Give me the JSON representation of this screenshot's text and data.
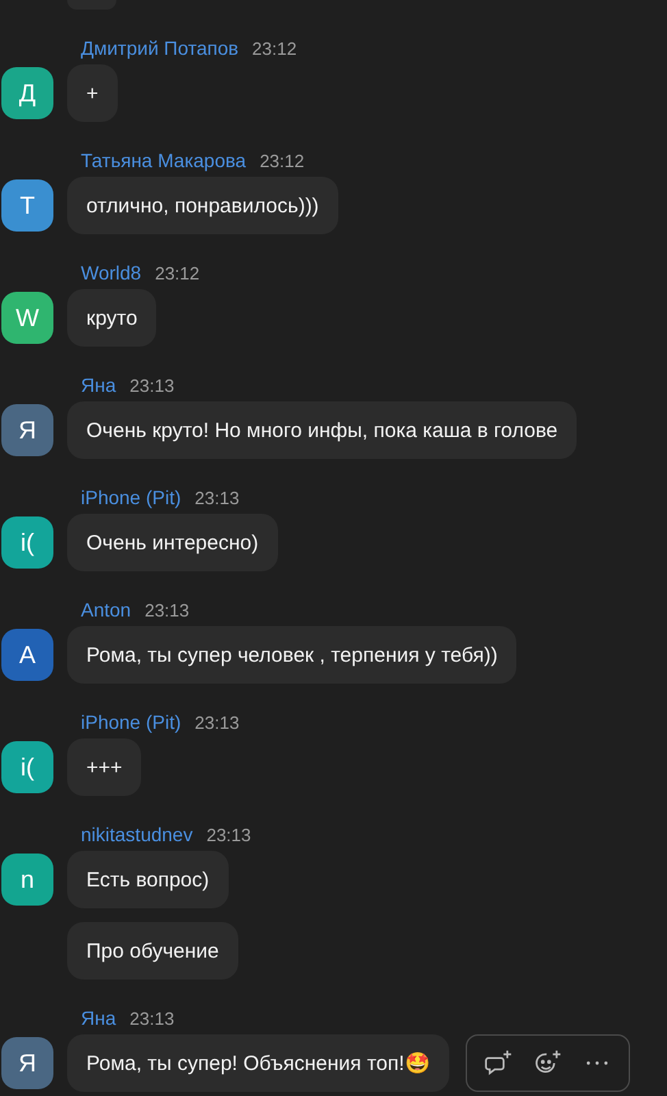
{
  "messages": [
    {
      "author": "Дмитрий Потапов",
      "time": "23:12",
      "avatar": "Д",
      "color": "#1aa68a",
      "bubbles": [
        "+"
      ],
      "hovered": false
    },
    {
      "author": "Татьяна Макарова",
      "time": "23:12",
      "avatar": "Т",
      "color": "#3a8fd0",
      "bubbles": [
        "отлично, понравилось)))"
      ],
      "hovered": false
    },
    {
      "author": "World8",
      "time": "23:12",
      "avatar": "W",
      "color": "#2fb56f",
      "bubbles": [
        "круто"
      ],
      "hovered": false
    },
    {
      "author": "Яна",
      "time": "23:13",
      "avatar": "Я",
      "color": "#4a6783",
      "bubbles": [
        "Очень круто! Но много инфы, пока каша в голове"
      ],
      "hovered": false
    },
    {
      "author": "iPhone (Pit)",
      "time": "23:13",
      "avatar": "i(",
      "color": "#13a59a",
      "bubbles": [
        "Очень интересно)"
      ],
      "hovered": false
    },
    {
      "author": "Anton",
      "time": "23:13",
      "avatar": "A",
      "color": "#2262b4",
      "bubbles": [
        "Рома, ты супер человек , терпения у тебя))"
      ],
      "hovered": false
    },
    {
      "author": "iPhone (Pit)",
      "time": "23:13",
      "avatar": "i(",
      "color": "#13a59a",
      "bubbles": [
        "+++"
      ],
      "hovered": false
    },
    {
      "author": "nikitastudnev",
      "time": "23:13",
      "avatar": "n",
      "color": "#13a590",
      "bubbles": [
        "Есть вопрос)",
        "Про обучение"
      ],
      "hovered": false
    },
    {
      "author": "Яна",
      "time": "23:13",
      "avatar": "Я",
      "color": "#4a6783",
      "bubbles": [
        "Рома, ты супер! Объяснения топ!🤩"
      ],
      "hovered": true
    }
  ]
}
